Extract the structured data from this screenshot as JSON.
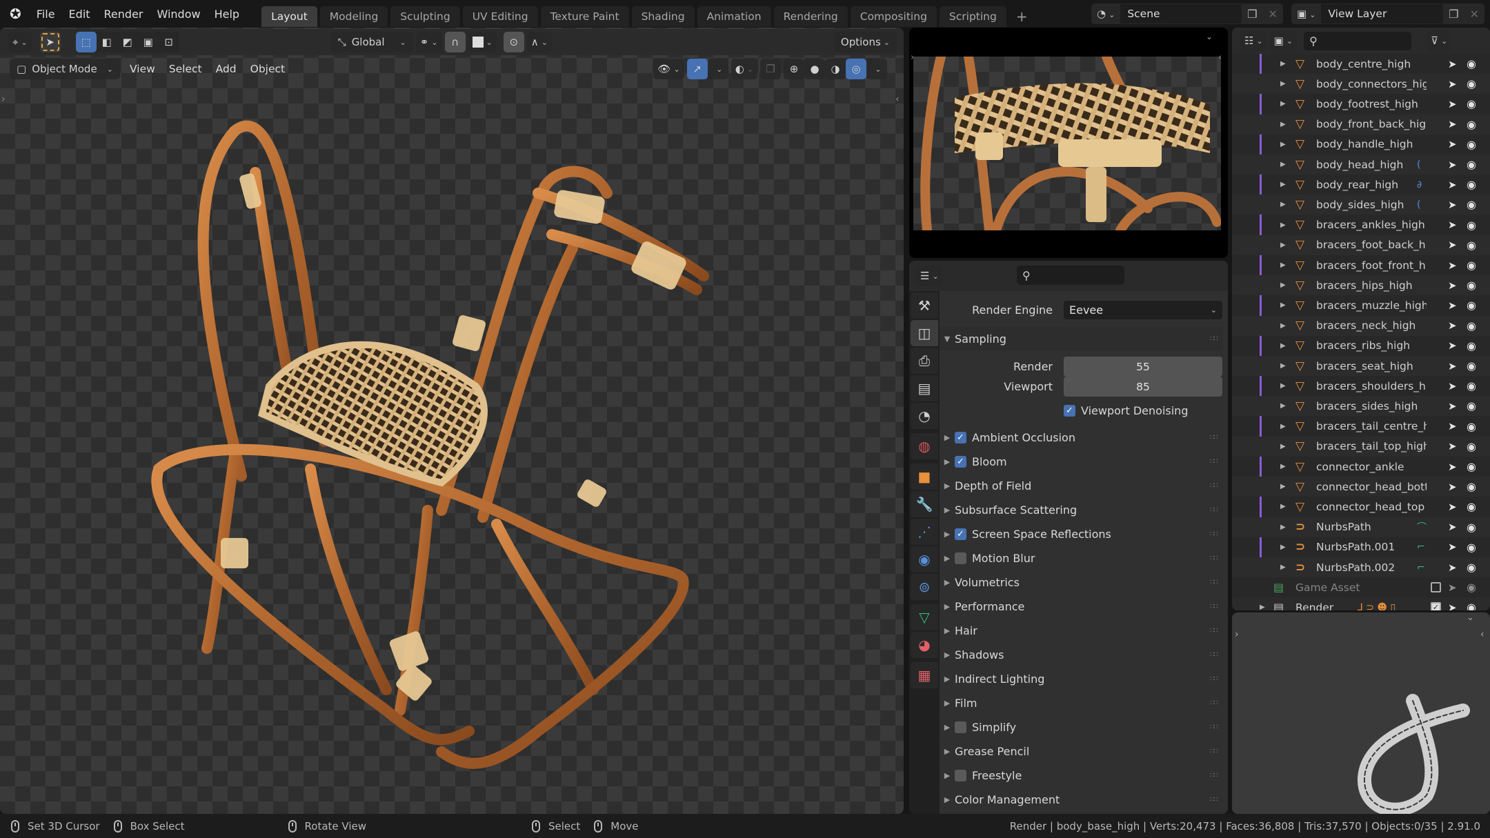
{
  "topbar": {
    "menus": [
      "File",
      "Edit",
      "Render",
      "Window",
      "Help"
    ],
    "workspaces": [
      "Layout",
      "Modeling",
      "Sculpting",
      "UV Editing",
      "Texture Paint",
      "Shading",
      "Animation",
      "Rendering",
      "Compositing",
      "Scripting"
    ],
    "active_workspace": "Layout",
    "add_workspace": "+",
    "scene": "Scene",
    "view_layer": "View Layer"
  },
  "viewport": {
    "transform_orientation": "Global",
    "options_label": "Options",
    "mode": "Object Mode",
    "menus": [
      "View",
      "Select",
      "Add",
      "Object"
    ],
    "active_shading": "material-preview"
  },
  "properties": {
    "search_placeholder": "",
    "render_engine_label": "Render Engine",
    "render_engine": "Eevee",
    "sampling": {
      "label": "Sampling",
      "render_label": "Render",
      "render_value": "55",
      "viewport_label": "Viewport",
      "viewport_value": "85",
      "denoise_label": "Viewport Denoising",
      "denoise_checked": true
    },
    "panels": [
      {
        "label": "Ambient Occlusion",
        "checkbox": true,
        "checked": true
      },
      {
        "label": "Bloom",
        "checkbox": true,
        "checked": true
      },
      {
        "label": "Depth of Field",
        "checkbox": false
      },
      {
        "label": "Subsurface Scattering",
        "checkbox": false
      },
      {
        "label": "Screen Space Reflections",
        "checkbox": true,
        "checked": true
      },
      {
        "label": "Motion Blur",
        "checkbox": true,
        "checked": false
      },
      {
        "label": "Volumetrics",
        "checkbox": false
      },
      {
        "label": "Performance",
        "checkbox": false
      },
      {
        "label": "Hair",
        "checkbox": false
      },
      {
        "label": "Shadows",
        "checkbox": false
      },
      {
        "label": "Indirect Lighting",
        "checkbox": false
      },
      {
        "label": "Film",
        "checkbox": false
      },
      {
        "label": "Simplify",
        "checkbox": true,
        "checked": false
      },
      {
        "label": "Grease Pencil",
        "checkbox": false
      },
      {
        "label": "Freestyle",
        "checkbox": true,
        "checked": false
      },
      {
        "label": "Color Management",
        "checkbox": false
      }
    ],
    "tabs": [
      {
        "name": "tool-tab",
        "icon": "tool-icon",
        "color": "#cfcfcf"
      },
      {
        "name": "render-tab",
        "icon": "camera-back-icon",
        "color": "#cfcfcf",
        "active": true
      },
      {
        "name": "output-tab",
        "icon": "printer-icon",
        "color": "#cfcfcf"
      },
      {
        "name": "view-layer-tab",
        "icon": "image-stack-icon",
        "color": "#cfcfcf"
      },
      {
        "name": "scene-tab",
        "icon": "scene-icon",
        "color": "#cfcfcf"
      },
      {
        "name": "world-tab",
        "icon": "world-icon",
        "color": "#d5555b"
      },
      {
        "name": "object-tab",
        "icon": "object-icon",
        "color": "#e8903c"
      },
      {
        "name": "modifier-tab",
        "icon": "wrench-icon",
        "color": "#5a8fd8"
      },
      {
        "name": "particles-tab",
        "icon": "particles-icon",
        "color": "#5a8fd8"
      },
      {
        "name": "physics-tab",
        "icon": "physics-icon",
        "color": "#5a8fd8"
      },
      {
        "name": "constraints-tab",
        "icon": "constraint-icon",
        "color": "#5a8fd8"
      },
      {
        "name": "data-tab",
        "icon": "mesh-data-icon",
        "color": "#2fb982"
      },
      {
        "name": "material-tab",
        "icon": "material-icon",
        "color": "#e0606a"
      },
      {
        "name": "texture-tab",
        "icon": "texture-icon",
        "color": "#e0606a"
      }
    ]
  },
  "outliner": {
    "search_placeholder": "",
    "items": [
      {
        "name": "body_centre_high",
        "type": "mesh"
      },
      {
        "name": "body_connectors_higl",
        "type": "mesh"
      },
      {
        "name": "body_footrest_high",
        "type": "mesh"
      },
      {
        "name": "body_front_back_high",
        "type": "mesh"
      },
      {
        "name": "body_handle_high",
        "type": "mesh"
      },
      {
        "name": "body_head_high",
        "type": "mesh",
        "extra": "("
      },
      {
        "name": "body_rear_high",
        "type": "mesh",
        "extra": "∂"
      },
      {
        "name": "body_sides_high",
        "type": "mesh",
        "extra": "("
      },
      {
        "name": "bracers_ankles_high",
        "type": "mesh"
      },
      {
        "name": "bracers_foot_back_hic",
        "type": "mesh"
      },
      {
        "name": "bracers_foot_front_hic",
        "type": "mesh"
      },
      {
        "name": "bracers_hips_high",
        "type": "mesh"
      },
      {
        "name": "bracers_muzzle_high",
        "type": "mesh"
      },
      {
        "name": "bracers_neck_high",
        "type": "mesh"
      },
      {
        "name": "bracers_ribs_high",
        "type": "mesh"
      },
      {
        "name": "bracers_seat_high",
        "type": "mesh"
      },
      {
        "name": "bracers_shoulders_hic",
        "type": "mesh"
      },
      {
        "name": "bracers_sides_high",
        "type": "mesh"
      },
      {
        "name": "bracers_tail_centre_hi",
        "type": "mesh"
      },
      {
        "name": "bracers_tail_top_high",
        "type": "mesh"
      },
      {
        "name": "connector_ankle",
        "type": "mesh"
      },
      {
        "name": "connector_head_bott",
        "type": "mesh"
      },
      {
        "name": "connector_head_top",
        "type": "mesh"
      },
      {
        "name": "NurbsPath",
        "type": "curve",
        "extra": "⌒"
      },
      {
        "name": "NurbsPath.001",
        "type": "curve",
        "extra": "⌐"
      },
      {
        "name": "NurbsPath.002",
        "type": "curve",
        "extra": "⌐"
      }
    ],
    "collections": [
      {
        "name": "Game Asset",
        "checked": false
      },
      {
        "name": "Render",
        "checked": true
      }
    ]
  },
  "statusbar": {
    "left": [
      {
        "icon": "mouse-left-icon",
        "label": "Set 3D Cursor"
      },
      {
        "icon": "mouse-drag-icon",
        "label": "Box Select"
      },
      {
        "icon": "mouse-middle-icon",
        "label": "Rotate View"
      },
      {
        "icon": "mouse-left-icon",
        "label": "Select"
      },
      {
        "icon": "mouse-drag-icon",
        "label": "Move"
      }
    ],
    "stats": "Render | body_base_high | Verts:20,473 | Faces:36,808 | Tris:37,570 | Objects:0/35 | 2.91.0"
  },
  "colors": {
    "accent_blue": "#4772b3",
    "mesh_orange": "#e8903c",
    "collection_line": "#8c5ad8"
  }
}
